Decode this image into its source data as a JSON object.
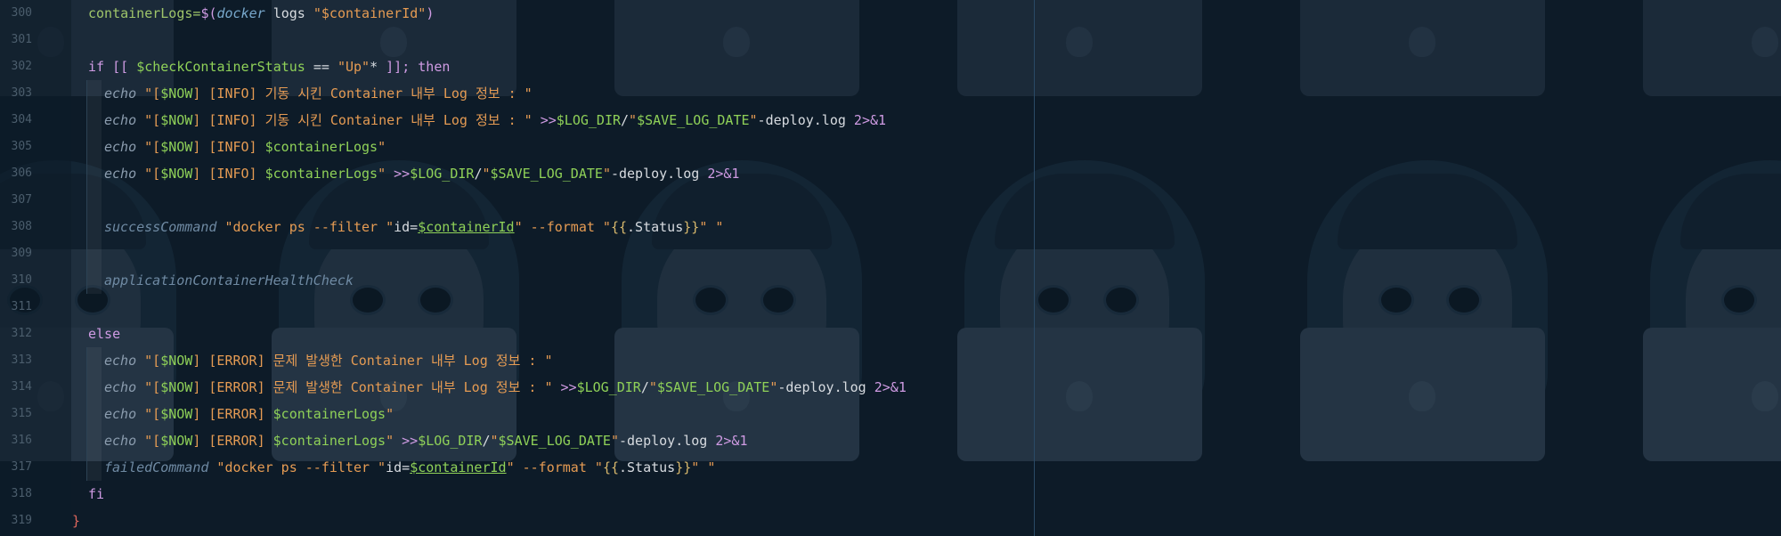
{
  "editor": {
    "language_icons": [
      "apple-logo-icon"
    ],
    "lines": [
      {
        "number": "300",
        "indent": 0,
        "tokens": [
          {
            "t": "containerLogs=",
            "c": "cmd"
          },
          {
            "t": "$(",
            "c": "kw"
          },
          {
            "t": "docker",
            "c": "fn"
          },
          {
            "t": " logs ",
            "c": "plain"
          },
          {
            "t": "\"$containerId\"",
            "c": "str"
          },
          {
            "t": ")",
            "c": "kw"
          }
        ]
      },
      {
        "number": "301",
        "indent": 0,
        "tokens": []
      },
      {
        "number": "302",
        "indent": 0,
        "tokens": [
          {
            "t": "if",
            "c": "kw"
          },
          {
            "t": " [[ ",
            "c": "kw"
          },
          {
            "t": "$checkContainerStatus",
            "c": "var"
          },
          {
            "t": " == ",
            "c": "plain"
          },
          {
            "t": "\"Up\"",
            "c": "str"
          },
          {
            "t": "* ",
            "c": "plain"
          },
          {
            "t": "]]; ",
            "c": "kw"
          },
          {
            "t": "then",
            "c": "kw"
          }
        ]
      },
      {
        "number": "303",
        "indent": 1,
        "tokens": [
          {
            "t": "echo",
            "c": "echo"
          },
          {
            "t": " \"[",
            "c": "str"
          },
          {
            "t": "$NOW",
            "c": "var"
          },
          {
            "t": "] [INFO] 기동 시킨 Container 내부 Log 정보 : \"",
            "c": "str"
          }
        ]
      },
      {
        "number": "304",
        "indent": 1,
        "tokens": [
          {
            "t": "echo",
            "c": "echo"
          },
          {
            "t": " \"[",
            "c": "str"
          },
          {
            "t": "$NOW",
            "c": "var"
          },
          {
            "t": "] [INFO] 기동 시킨 Container 내부 Log 정보 : \" ",
            "c": "str"
          },
          {
            "t": ">>",
            "c": "kw"
          },
          {
            "t": "$LOG_DIR",
            "c": "var"
          },
          {
            "t": "/",
            "c": "plain"
          },
          {
            "t": "\"",
            "c": "str"
          },
          {
            "t": "$SAVE_LOG_DATE",
            "c": "var"
          },
          {
            "t": "\"",
            "c": "str"
          },
          {
            "t": "-deploy.log ",
            "c": "plain"
          },
          {
            "t": "2>&1",
            "c": "kw"
          }
        ]
      },
      {
        "number": "305",
        "indent": 1,
        "tokens": [
          {
            "t": "echo",
            "c": "echo"
          },
          {
            "t": " \"[",
            "c": "str"
          },
          {
            "t": "$NOW",
            "c": "var"
          },
          {
            "t": "] [INFO] ",
            "c": "str"
          },
          {
            "t": "$containerLogs",
            "c": "var"
          },
          {
            "t": "\"",
            "c": "str"
          }
        ]
      },
      {
        "number": "306",
        "indent": 1,
        "tokens": [
          {
            "t": "echo",
            "c": "echo"
          },
          {
            "t": " \"[",
            "c": "str"
          },
          {
            "t": "$NOW",
            "c": "var"
          },
          {
            "t": "] [INFO] ",
            "c": "str"
          },
          {
            "t": "$containerLogs",
            "c": "var"
          },
          {
            "t": "\" ",
            "c": "str"
          },
          {
            "t": ">>",
            "c": "kw"
          },
          {
            "t": "$LOG_DIR",
            "c": "var"
          },
          {
            "t": "/",
            "c": "plain"
          },
          {
            "t": "\"",
            "c": "str"
          },
          {
            "t": "$SAVE_LOG_DATE",
            "c": "var"
          },
          {
            "t": "\"",
            "c": "str"
          },
          {
            "t": "-deploy.log ",
            "c": "plain"
          },
          {
            "t": "2>&1",
            "c": "kw"
          }
        ]
      },
      {
        "number": "307",
        "indent": 1,
        "tokens": []
      },
      {
        "number": "308",
        "indent": 1,
        "tokens": [
          {
            "t": "successCommand",
            "c": "fn2"
          },
          {
            "t": " \"docker ps --filter \"",
            "c": "str"
          },
          {
            "t": "id=",
            "c": "plain"
          },
          {
            "t": "$containerId",
            "c": "var und"
          },
          {
            "t": "\" --format \"",
            "c": "str"
          },
          {
            "t": "{{",
            "c": "brace"
          },
          {
            "t": ".Status",
            "c": "plain"
          },
          {
            "t": "}}",
            "c": "brace"
          },
          {
            "t": "\" \"",
            "c": "str"
          }
        ]
      },
      {
        "number": "309",
        "indent": 1,
        "tokens": []
      },
      {
        "number": "310",
        "indent": 1,
        "tokens": [
          {
            "t": "applicationContainerHealthCheck",
            "c": "fn2"
          }
        ]
      },
      {
        "number": "311",
        "indent": 0,
        "tokens": []
      },
      {
        "number": "312",
        "indent": 0,
        "tokens": [
          {
            "t": "else",
            "c": "kw"
          }
        ]
      },
      {
        "number": "313",
        "indent": 1,
        "tokens": [
          {
            "t": "echo",
            "c": "echo"
          },
          {
            "t": " \"[",
            "c": "str"
          },
          {
            "t": "$NOW",
            "c": "var"
          },
          {
            "t": "] [ERROR] 문제 발생한 Container 내부 Log 정보 : \"",
            "c": "str"
          }
        ]
      },
      {
        "number": "314",
        "indent": 1,
        "tokens": [
          {
            "t": "echo",
            "c": "echo"
          },
          {
            "t": " \"[",
            "c": "str"
          },
          {
            "t": "$NOW",
            "c": "var"
          },
          {
            "t": "] [ERROR] 문제 발생한 Container 내부 Log 정보 : \" ",
            "c": "str"
          },
          {
            "t": ">>",
            "c": "kw"
          },
          {
            "t": "$LOG_DIR",
            "c": "var"
          },
          {
            "t": "/",
            "c": "plain"
          },
          {
            "t": "\"",
            "c": "str"
          },
          {
            "t": "$SAVE_LOG_DATE",
            "c": "var"
          },
          {
            "t": "\"",
            "c": "str"
          },
          {
            "t": "-deploy.log ",
            "c": "plain"
          },
          {
            "t": "2>&1",
            "c": "kw"
          }
        ]
      },
      {
        "number": "315",
        "indent": 1,
        "tokens": [
          {
            "t": "echo",
            "c": "echo"
          },
          {
            "t": " \"[",
            "c": "str"
          },
          {
            "t": "$NOW",
            "c": "var"
          },
          {
            "t": "] [ERROR] ",
            "c": "str"
          },
          {
            "t": "$containerLogs",
            "c": "var"
          },
          {
            "t": "\"",
            "c": "str"
          }
        ]
      },
      {
        "number": "316",
        "indent": 1,
        "tokens": [
          {
            "t": "echo",
            "c": "echo"
          },
          {
            "t": " \"[",
            "c": "str"
          },
          {
            "t": "$NOW",
            "c": "var"
          },
          {
            "t": "] [ERROR] ",
            "c": "str"
          },
          {
            "t": "$containerLogs",
            "c": "var"
          },
          {
            "t": "\" ",
            "c": "str"
          },
          {
            "t": ">>",
            "c": "kw"
          },
          {
            "t": "$LOG_DIR",
            "c": "var"
          },
          {
            "t": "/",
            "c": "plain"
          },
          {
            "t": "\"",
            "c": "str"
          },
          {
            "t": "$SAVE_LOG_DATE",
            "c": "var"
          },
          {
            "t": "\"",
            "c": "str"
          },
          {
            "t": "-deploy.log ",
            "c": "plain"
          },
          {
            "t": "2>&1",
            "c": "kw"
          }
        ]
      },
      {
        "number": "317",
        "indent": 1,
        "tokens": [
          {
            "t": "failedCommand",
            "c": "fn2"
          },
          {
            "t": " \"docker ps --filter \"",
            "c": "str"
          },
          {
            "t": "id=",
            "c": "plain"
          },
          {
            "t": "$containerId",
            "c": "var und"
          },
          {
            "t": "\" --format \"",
            "c": "str"
          },
          {
            "t": "{{",
            "c": "brace"
          },
          {
            "t": ".Status",
            "c": "plain"
          },
          {
            "t": "}}",
            "c": "brace"
          },
          {
            "t": "\" \"",
            "c": "str"
          }
        ]
      },
      {
        "number": "318",
        "indent": 0,
        "tokens": [
          {
            "t": "fi",
            "c": "kw"
          }
        ]
      },
      {
        "number": "319",
        "indent": -1,
        "tokens": [
          {
            "t": "}",
            "c": "red"
          }
        ]
      }
    ]
  },
  "colors": {
    "background": "#0d1b28",
    "keyword": "#cf9be3",
    "string": "#e59b53",
    "variable": "#8fd158",
    "line_number": "#4b5d6c"
  }
}
